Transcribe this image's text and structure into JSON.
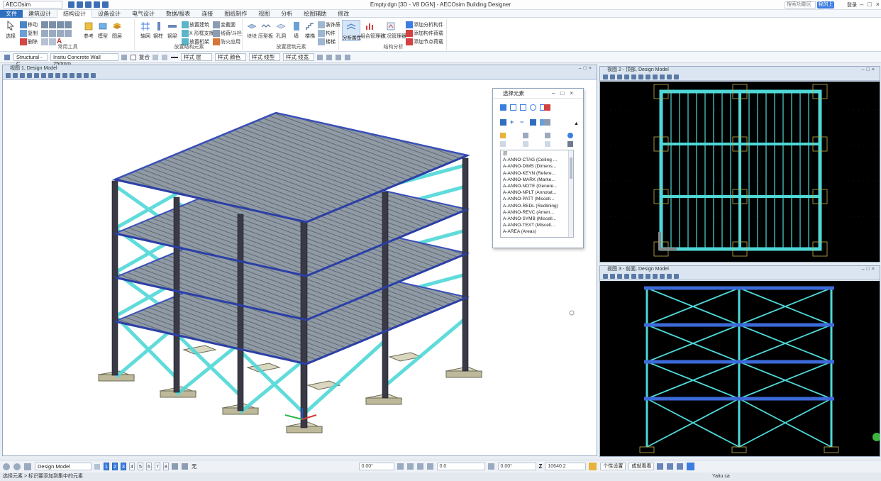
{
  "titlebar": {
    "app_combo": "AECOsim",
    "document_title": "Empty.dgn [3D - V8 DGN] - AECOsim Building Designer",
    "search_placeholder": "搜索功能区",
    "cloud_button": "我的上传",
    "login": "登录"
  },
  "menu": {
    "tabs": [
      "文件",
      "建筑设计",
      "结构设计",
      "设备设计",
      "电气设计",
      "数据/报表",
      "连接",
      "图纸制作",
      "视图",
      "分析",
      "绘图辅助",
      "修改"
    ],
    "active_index": 2
  },
  "ribbon": {
    "group_common": {
      "label": "常用工具",
      "select": "选择",
      "move": "移动",
      "copy": "复制",
      "delete": "删除",
      "reference": "参考",
      "model": "模型",
      "layer": "图层"
    },
    "group_members": {
      "label": "放置结构元素",
      "grid": "轴网",
      "column": "钢柱",
      "beam": "钢梁",
      "place_brace": "放置建筑",
      "truss_frame": "X 形框支撑",
      "place_truss": "放置桁架",
      "slab": "变截面",
      "brace": "线荷/斗栏",
      "fireproof": "防火应用"
    },
    "group_building": {
      "label": "放置建筑元素",
      "block": "块块",
      "wall_slab": "压型板",
      "opening": "孔洞",
      "wall": "墙",
      "stair": "楼梯",
      "decoration": "装饰质",
      "component": "构件",
      "stairs2": "楼梯"
    },
    "group_analysis": {
      "label": "结构分析",
      "analysis_properties": "分析属性",
      "load_manager": "组合管理器",
      "condition_manager": "工况管理器",
      "add_analysis_member": "添加分析构件",
      "add_member_load": "添加构件荷载",
      "add_node_load": "添加节点荷载"
    }
  },
  "propbar": {
    "structural": "Structural - C",
    "wall": "Insitu Concrete Wall 250mm",
    "checkbox_label": "复合",
    "layer_label": "层",
    "color_label": "颜色",
    "linestyle_label": "线型",
    "weight_label": "线宽",
    "style_prefix": "样式"
  },
  "views": {
    "v1_title": "视图 1, Design Model",
    "v2_title": "视图 2 - 顶部, Design Model",
    "v3_title": "视图 3 - 前面, Design Model"
  },
  "dialog": {
    "title": "选择元素",
    "list_header": "层",
    "layers": [
      "A-ANNO-CTAG (Ceiling ...",
      "A-ANNO-DIMS (Dimens...",
      "A-ANNO-KEYN (Refere...",
      "A-ANNO-MARK (Marke...",
      "A-ANNO-NOTE (Genere...",
      "A-ANNO-NPLT (Annotat...",
      "A-ANNO-PATT (Miscell...",
      "A-ANNO-REDL (Redlining)",
      "A-ANNO-REVC (Amen...",
      "A-ANNO-SYMB (Miscell...",
      "A-ANNO-TEXT (Miscell...",
      "A-AREA (Areas)"
    ]
  },
  "statusbar": {
    "model": "Design Model",
    "view_numbers": [
      "1",
      "2",
      "3",
      "4",
      "5",
      "6",
      "7",
      "8"
    ],
    "active_views": [
      "1",
      "2",
      "3"
    ],
    "no_snap": "无",
    "angle1": "0.00°",
    "x_value": "0.0",
    "angle2": "0.00°",
    "z_label": "Z",
    "z_value": "10640.2",
    "popup_1": "个性设置",
    "popup_2": "成就看看",
    "message": "选择元素 > 标识要添加到集中的元素",
    "tray_text": "Yaitu ca"
  },
  "colors": {
    "accent": "#2f6fc0",
    "view_bg_dark": "#000000",
    "brace_cyan": "#4fd8d8",
    "column_dark": "#3a3a46",
    "slab_gray": "#8f9aa5"
  }
}
